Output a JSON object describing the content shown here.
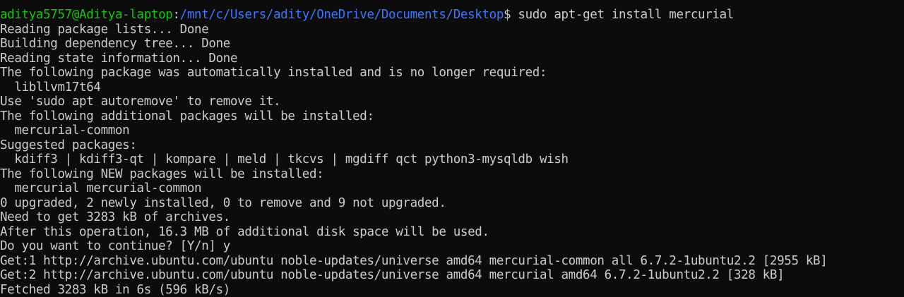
{
  "prompt": {
    "user_host": "aditya5757@Aditya-laptop",
    "separator": ":",
    "path": "/mnt/c/Users/adity/OneDrive/Documents/Desktop",
    "symbol": "$",
    "command": " sudo apt-get install mercurial"
  },
  "output_lines": [
    "Reading package lists... Done",
    "Building dependency tree... Done",
    "Reading state information... Done",
    "The following package was automatically installed and is no longer required:",
    "  libllvm17t64",
    "Use 'sudo apt autoremove' to remove it.",
    "The following additional packages will be installed:",
    "  mercurial-common",
    "Suggested packages:",
    "  kdiff3 | kdiff3-qt | kompare | meld | tkcvs | mgdiff qct python3-mysqldb wish",
    "The following NEW packages will be installed:",
    "  mercurial mercurial-common",
    "0 upgraded, 2 newly installed, 0 to remove and 9 not upgraded.",
    "Need to get 3283 kB of archives.",
    "After this operation, 16.3 MB of additional disk space will be used.",
    "Do you want to continue? [Y/n] y",
    "Get:1 http://archive.ubuntu.com/ubuntu noble-updates/universe amd64 mercurial-common all 6.7.2-1ubuntu2.2 [2955 kB]",
    "Get:2 http://archive.ubuntu.com/ubuntu noble-updates/universe amd64 mercurial amd64 6.7.2-1ubuntu2.2 [328 kB]",
    "Fetched 3283 kB in 6s (596 kB/s)"
  ],
  "colors": {
    "background": "#0c0c0c",
    "foreground": "#cccccc",
    "user_host": "#16c60c",
    "path": "#3b78ff"
  }
}
